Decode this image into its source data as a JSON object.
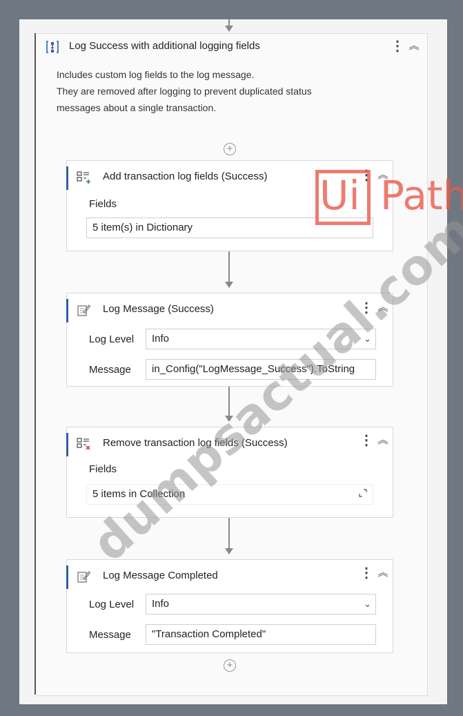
{
  "sequence": {
    "title": "Log Success with additional logging fields",
    "annotation": [
      "Includes custom log fields to the log message.",
      "They are removed after logging to prevent duplicated status",
      "messages about a single transaction."
    ]
  },
  "activities": [
    {
      "title": "Add transaction log fields (Success)",
      "fields_label": "Fields",
      "fields_value": "5 item(s) in Dictionary"
    },
    {
      "title": "Log Message (Success)",
      "level_label": "Log Level",
      "level_value": "Info",
      "message_label": "Message",
      "message_value": "in_Config(\"LogMessage_Success\").ToString"
    },
    {
      "title": "Remove transaction log fields (Success)",
      "fields_label": "Fields",
      "fields_value": "5 items in Collection"
    },
    {
      "title": "Log Message Completed",
      "level_label": "Log Level",
      "level_value": "Info",
      "message_label": "Message",
      "message_value": "\"Transaction Completed\""
    }
  ],
  "watermark": {
    "text": "dumpsactual.com",
    "logo_ui": "Ui",
    "logo_path": "Path"
  },
  "colors": {
    "accent": "#2d5fa8",
    "logo": "#e85a4b"
  }
}
